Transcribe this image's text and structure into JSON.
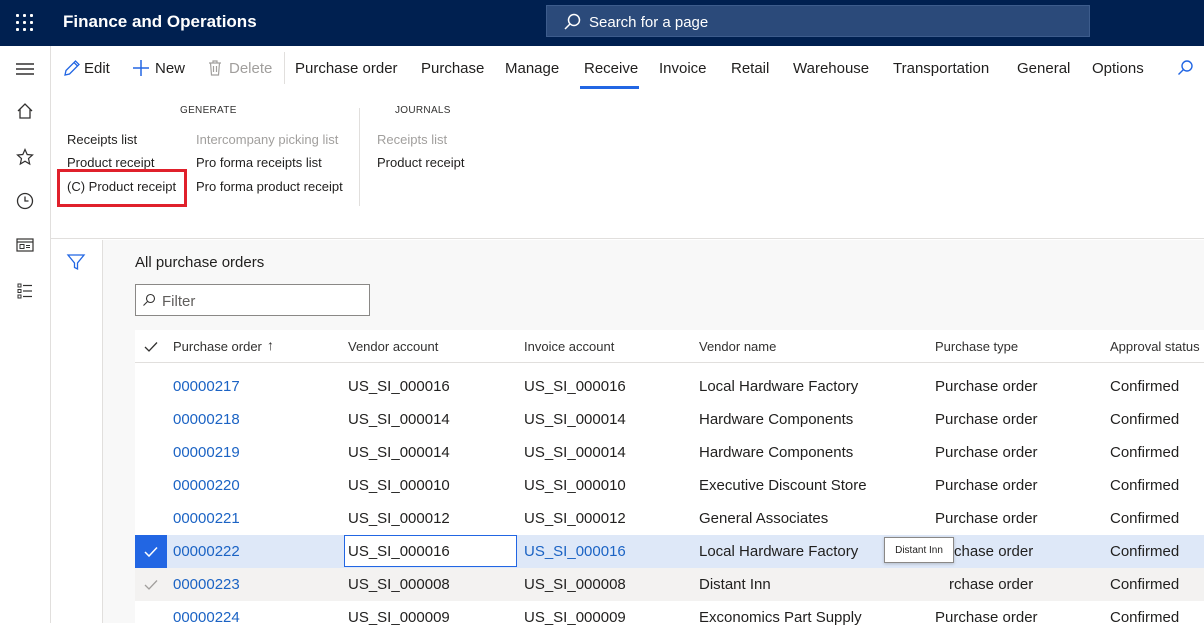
{
  "app": {
    "title": "Finance and Operations"
  },
  "search": {
    "placeholder": "Search for a page"
  },
  "actions": {
    "edit": "Edit",
    "new": "New",
    "delete": "Delete",
    "tabs": [
      "Purchase order",
      "Purchase",
      "Manage",
      "Receive",
      "Invoice",
      "Retail",
      "Warehouse",
      "Transportation",
      "General",
      "Options"
    ],
    "selected_tab": "Receive"
  },
  "ribbon": {
    "generate": {
      "label": "GENERATE",
      "col1": [
        "Receipts list",
        "Product receipt",
        "(C) Product receipt"
      ],
      "col2": [
        "Intercompany picking list",
        "Pro forma receipts list",
        "Pro forma product receipt"
      ]
    },
    "journals": {
      "label": "JOURNALS",
      "items": [
        "Receipts list",
        "Product receipt"
      ]
    }
  },
  "page": {
    "title": "All purchase orders",
    "filter_placeholder": "Filter"
  },
  "grid": {
    "columns": [
      "Purchase order",
      "Vendor account",
      "Invoice account",
      "Vendor name",
      "Purchase type",
      "Approval status"
    ],
    "sort_indicator": "↑",
    "rows": [
      {
        "po": "00000217",
        "vendor": "US_SI_000016",
        "invoice": "US_SI_000016",
        "name": "Local Hardware Factory",
        "type": "Purchase order",
        "status": "Confirmed"
      },
      {
        "po": "00000218",
        "vendor": "US_SI_000014",
        "invoice": "US_SI_000014",
        "name": "Hardware Components",
        "type": "Purchase order",
        "status": "Confirmed"
      },
      {
        "po": "00000219",
        "vendor": "US_SI_000014",
        "invoice": "US_SI_000014",
        "name": "Hardware Components",
        "type": "Purchase order",
        "status": "Confirmed"
      },
      {
        "po": "00000220",
        "vendor": "US_SI_000010",
        "invoice": "US_SI_000010",
        "name": "Executive Discount Store",
        "type": "Purchase order",
        "status": "Confirmed"
      },
      {
        "po": "00000221",
        "vendor": "US_SI_000012",
        "invoice": "US_SI_000012",
        "name": "General Associates",
        "type": "Purchase order",
        "status": "Confirmed"
      },
      {
        "po": "00000222",
        "vendor": "US_SI_000016",
        "invoice": "US_SI_000016",
        "name": "Local Hardware Factory",
        "type": "rchase order",
        "status": "Confirmed"
      },
      {
        "po": "00000223",
        "vendor": "US_SI_000008",
        "invoice": "US_SI_000008",
        "name": "Distant Inn",
        "type": "rchase order",
        "status": "Confirmed"
      },
      {
        "po": "00000224",
        "vendor": "US_SI_000009",
        "invoice": "US_SI_000009",
        "name": "Exconomics Part Supply",
        "type": "Purchase order",
        "status": "Confirmed"
      }
    ]
  },
  "tooltip": {
    "text": "Distant Inn"
  },
  "colors": {
    "topbar": "#002050",
    "accent": "#2266e3",
    "link": "#1b63c4",
    "highlight_box": "#e0202b"
  },
  "icons": [
    "waffle-icon",
    "search-icon",
    "hamburger-icon",
    "home-icon",
    "star-icon",
    "clock-icon",
    "workspace-icon",
    "list-icon",
    "pencil-icon",
    "plus-icon",
    "trash-icon",
    "filter-icon",
    "check-icon"
  ]
}
